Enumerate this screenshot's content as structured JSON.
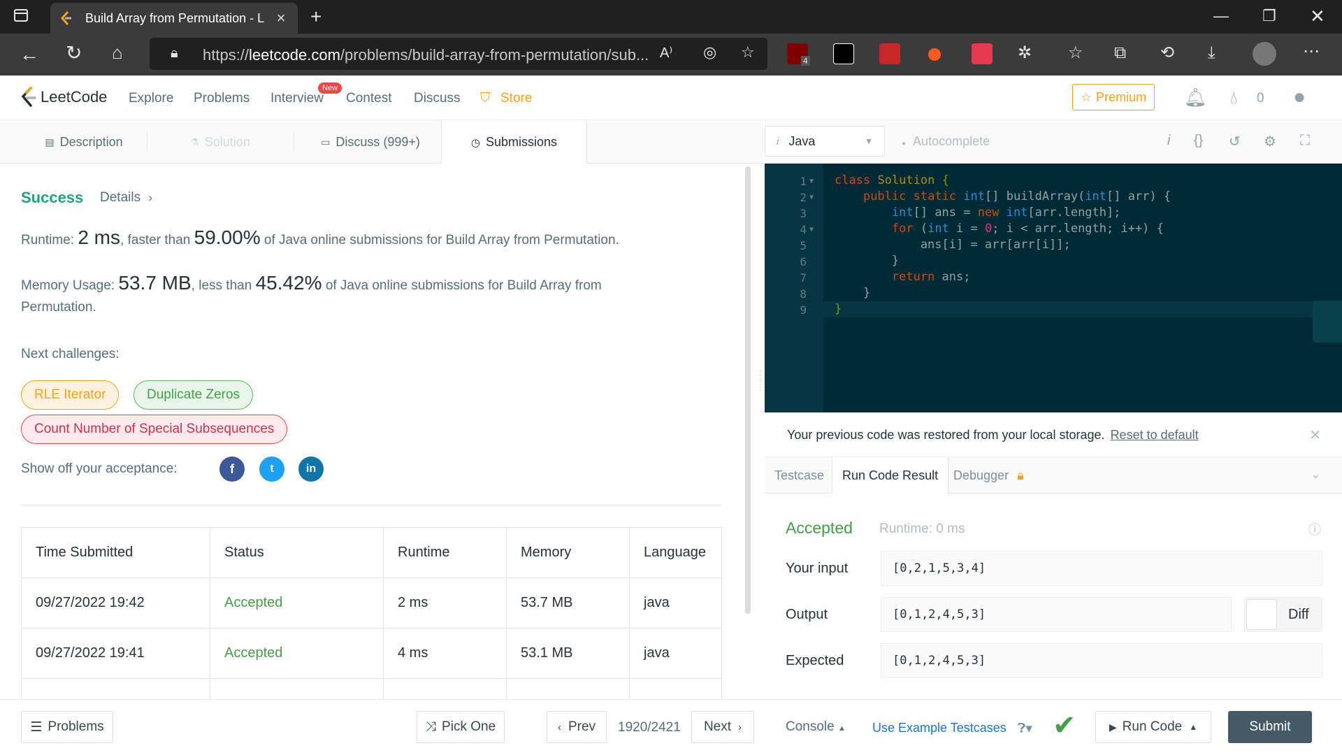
{
  "browser": {
    "tab_title": "Build Array from Permutation - L",
    "url_prefix": "https://",
    "url_domain": "leetcode.com",
    "url_path": "/problems/build-array-from-permutation/sub...",
    "ext_badge_count": "4"
  },
  "nav": {
    "logo": "LeetCode",
    "explore": "Explore",
    "problems": "Problems",
    "interview": "Interview",
    "new_badge": "New",
    "contest": "Contest",
    "discuss": "Discuss",
    "store": "Store",
    "premium": "Premium",
    "streak": "0"
  },
  "left_tabs": {
    "description": "Description",
    "solution": "Solution",
    "discuss": "Discuss (999+)",
    "submissions": "Submissions"
  },
  "result": {
    "status": "Success",
    "details": "Details",
    "runtime_label": "Runtime:",
    "runtime_value": "2 ms",
    "runtime_mid": ", faster than",
    "runtime_pct": "59.00%",
    "runtime_tail": "of Java online submissions for Build Array from Permutation.",
    "memory_label": "Memory Usage:",
    "memory_value": "53.7 MB",
    "memory_mid": ", less than",
    "memory_pct": "45.42%",
    "memory_tail": "of Java online submissions for Build Array from Permutation.",
    "next_challenges": "Next challenges:",
    "challenges": [
      "RLE Iterator",
      "Duplicate Zeros",
      "Count Number of Special Subsequences"
    ],
    "show_off": "Show off your acceptance:"
  },
  "submissions": {
    "headers": [
      "Time Submitted",
      "Status",
      "Runtime",
      "Memory",
      "Language"
    ],
    "rows": [
      [
        "09/27/2022 19:42",
        "Accepted",
        "2 ms",
        "53.7 MB",
        "java"
      ],
      [
        "09/27/2022 19:41",
        "Accepted",
        "4 ms",
        "53.1 MB",
        "java"
      ]
    ]
  },
  "editor": {
    "language": "Java",
    "autocomplete": "Autocomplete",
    "line_numbers": [
      "1",
      "2",
      "3",
      "4",
      "5",
      "6",
      "7",
      "8",
      "9"
    ]
  },
  "notice": {
    "text": "Your previous code was restored from your local storage.",
    "link": "Reset to default"
  },
  "console_tabs": {
    "testcase": "Testcase",
    "run_result": "Run Code Result",
    "debugger": "Debugger"
  },
  "run": {
    "status": "Accepted",
    "runtime": "Runtime: 0 ms",
    "input_label": "Your input",
    "input": "[0,2,1,5,3,4]",
    "output_label": "Output",
    "output": "[0,1,2,4,5,3]",
    "expected_label": "Expected",
    "expected": "[0,1,2,4,5,3]",
    "diff": "Diff"
  },
  "bottom": {
    "problems": "Problems",
    "pick_one": "Pick One",
    "prev": "Prev",
    "counter": "1920/2421",
    "next": "Next",
    "console": "Console",
    "use_example": "Use Example Testcases",
    "run_code": "Run Code",
    "submit": "Submit"
  },
  "colors": {
    "accent": "#ffa116",
    "success": "#43a047",
    "editor_bg": "#002b36"
  }
}
